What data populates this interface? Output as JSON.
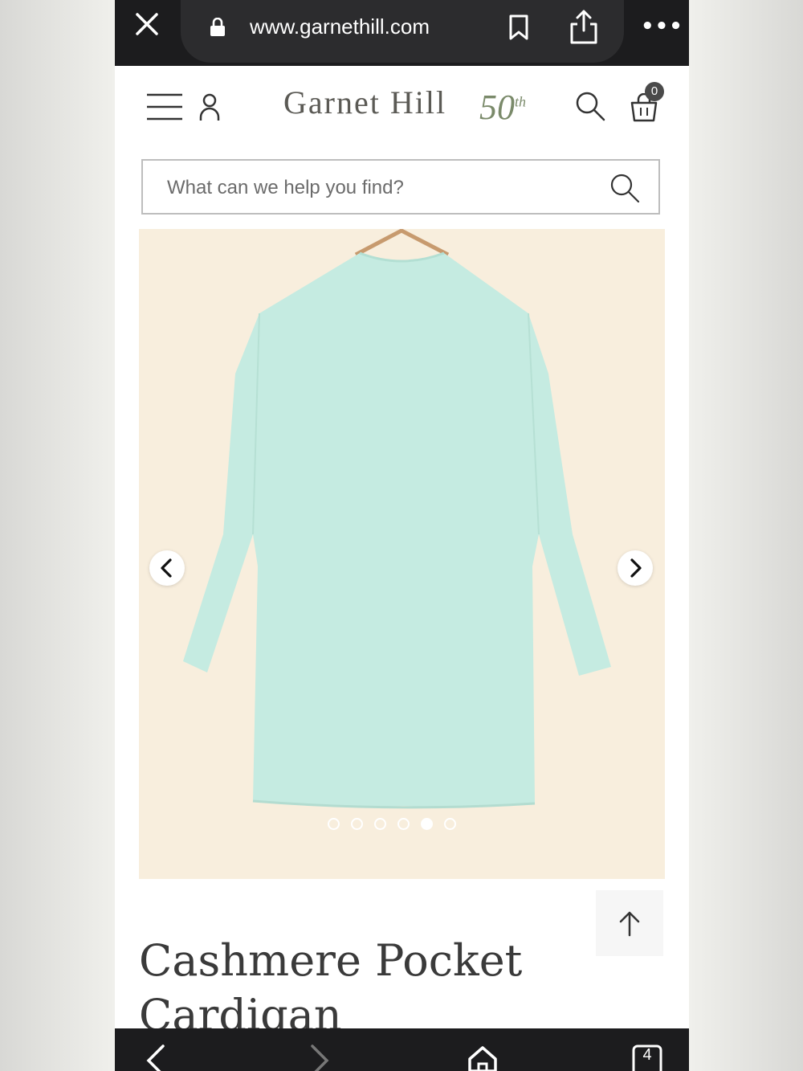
{
  "browser": {
    "url": "www.garnethill.com",
    "close_icon": "close-icon",
    "more_label": "•••",
    "tab_count": "4"
  },
  "header": {
    "logo_text": "Garnet Hill",
    "logo_anniversary": "50",
    "logo_anniversary_suffix": "th",
    "cart_count": "0"
  },
  "search": {
    "placeholder": "What can we help you find?"
  },
  "gallery": {
    "image_count": 6,
    "active_index": 4,
    "garment_color": "#c5ebe1",
    "background_color": "#f8eedd"
  },
  "product": {
    "title_line1": "Cashmere Pocket",
    "title_line2": "Cardigan"
  }
}
